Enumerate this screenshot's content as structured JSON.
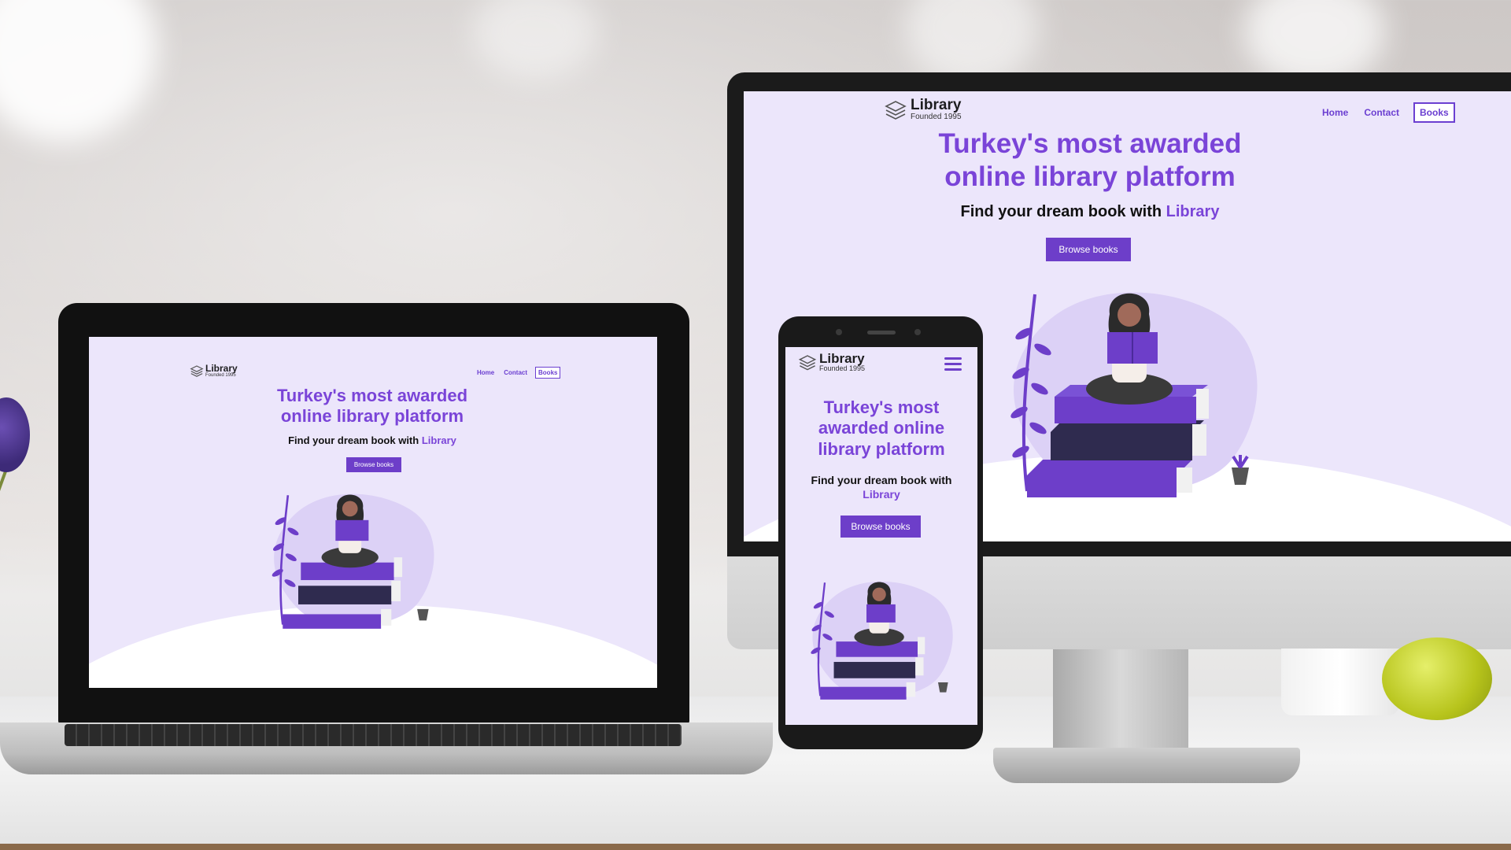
{
  "site": {
    "logo": {
      "name": "Library",
      "tagline": "Founded 1995"
    },
    "nav": {
      "home": "Home",
      "contact": "Contact",
      "books": "Books"
    },
    "hero": {
      "headline_line1": "Turkey's most awarded",
      "headline_line2": "online library platform",
      "sub_text": "Find your dream book with",
      "sub_highlight": "Library",
      "button": "Browse books"
    },
    "mobile": {
      "headline_line1": "Turkey's most",
      "headline_line2": "awarded online",
      "headline_line3": "library platform",
      "sub_line1": "Find your dream book with",
      "menu_icon": "hamburger-menu-icon"
    }
  },
  "colors": {
    "accent": "#7a44d8",
    "button": "#6d3ec9",
    "page_bg": "#ece6fb",
    "dark_book": "#2f2b4f",
    "light_book": "#6d3ec9"
  }
}
